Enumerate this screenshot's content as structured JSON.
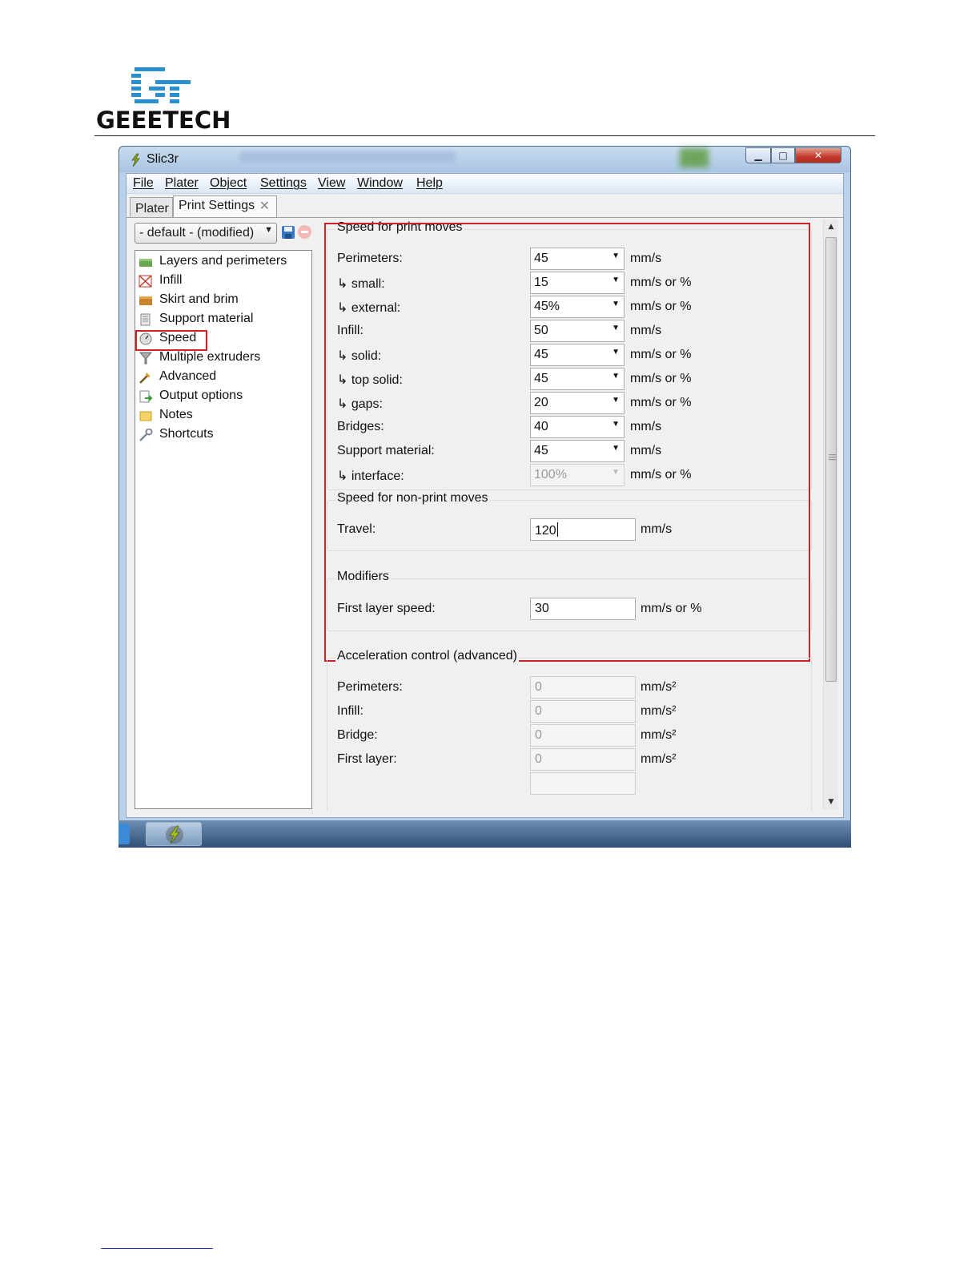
{
  "document": {
    "brand": "GEEETECH"
  },
  "window": {
    "title": "Slic3r",
    "controls": {
      "minimize": "▁",
      "maximize": "□",
      "close": "✕"
    }
  },
  "menu": [
    "File",
    "Plater",
    "Object",
    "Settings",
    "View",
    "Window",
    "Help"
  ],
  "tabs": [
    {
      "label": "Plater",
      "active": false
    },
    {
      "label": "Print Settings",
      "active": true,
      "close": "✕"
    }
  ],
  "preset": {
    "value": "- default - (modified)"
  },
  "tree": {
    "selected": "Speed",
    "items": [
      {
        "label": "Layers and perimeters",
        "icon": "layers-icon"
      },
      {
        "label": "Infill",
        "icon": "infill-icon"
      },
      {
        "label": "Skirt and brim",
        "icon": "skirt-icon"
      },
      {
        "label": "Support material",
        "icon": "support-icon"
      },
      {
        "label": "Speed",
        "icon": "speed-icon"
      },
      {
        "label": "Multiple extruders",
        "icon": "extruders-icon"
      },
      {
        "label": "Advanced",
        "icon": "advanced-icon"
      },
      {
        "label": "Output options",
        "icon": "output-icon"
      },
      {
        "label": "Notes",
        "icon": "notes-icon"
      },
      {
        "label": "Shortcuts",
        "icon": "shortcuts-icon"
      }
    ]
  },
  "groups": {
    "print_moves": {
      "title": "Speed for print moves",
      "rows": [
        {
          "label": "Perimeters:",
          "value": "45",
          "unit": "mm/s"
        },
        {
          "label": "↳ small:",
          "value": "15",
          "unit": "mm/s or %"
        },
        {
          "label": "↳ external:",
          "value": "45%",
          "unit": "mm/s or %"
        },
        {
          "label": "Infill:",
          "value": "50",
          "unit": "mm/s"
        },
        {
          "label": "↳ solid:",
          "value": "45",
          "unit": "mm/s or %"
        },
        {
          "label": "↳ top solid:",
          "value": "45",
          "unit": "mm/s or %"
        },
        {
          "label": "↳ gaps:",
          "value": "20",
          "unit": "mm/s or %"
        },
        {
          "label": "Bridges:",
          "value": "40",
          "unit": "mm/s"
        },
        {
          "label": "Support material:",
          "value": "45",
          "unit": "mm/s"
        },
        {
          "label": "↳ interface:",
          "value": "100%",
          "unit": "mm/s or %",
          "disabled": true
        }
      ]
    },
    "non_print_moves": {
      "title": "Speed for non-print moves",
      "rows": [
        {
          "label": "Travel:",
          "value": "120",
          "unit": "mm/s"
        }
      ]
    },
    "modifiers": {
      "title": "Modifiers",
      "rows": [
        {
          "label": "First layer speed:",
          "value": "30",
          "unit": "mm/s or %"
        }
      ]
    },
    "acceleration": {
      "title": "Acceleration control (advanced)",
      "rows": [
        {
          "label": "Perimeters:",
          "value": "0",
          "unit": "mm/s²"
        },
        {
          "label": "Infill:",
          "value": "0",
          "unit": "mm/s²"
        },
        {
          "label": "Bridge:",
          "value": "0",
          "unit": "mm/s²"
        },
        {
          "label": "First layer:",
          "value": "0",
          "unit": "mm/s²"
        }
      ]
    }
  },
  "colors": {
    "highlight": "#d22027",
    "titlebar": "#b9d1ea",
    "panel": "#f0f0f0"
  }
}
